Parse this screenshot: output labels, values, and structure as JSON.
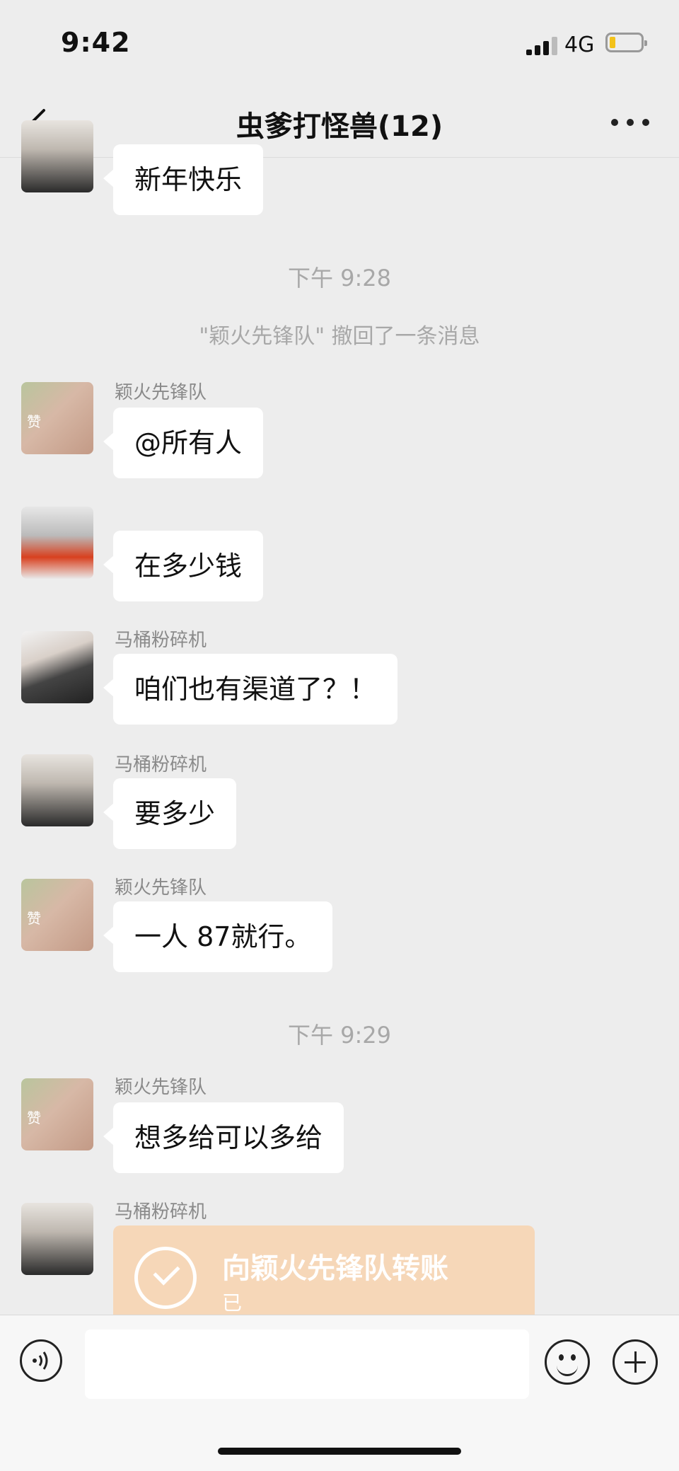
{
  "status": {
    "time": "9:42",
    "network": "4G"
  },
  "header": {
    "title": "虫爹打怪兽(12)"
  },
  "timestamps": [
    "下午 9:28",
    "下午 9:29"
  ],
  "system_message": "\"颖火先锋队\" 撤回了一条消息",
  "messages": [
    {
      "sender": "",
      "text": "新年快乐"
    },
    {
      "sender": "颖火先锋队",
      "text": "@所有人"
    },
    {
      "sender": "",
      "text": "在多少钱"
    },
    {
      "sender": "马桶粉碎机",
      "text": "咱们也有渠道了？！"
    },
    {
      "sender": "马桶粉碎机",
      "text": "要多少"
    },
    {
      "sender": "颖火先锋队",
      "text": "一人 87就行。"
    },
    {
      "sender": "颖火先锋队",
      "text": "想多给可以多给"
    },
    {
      "sender": "马桶粉碎机",
      "text": ""
    }
  ],
  "transfer": {
    "title": "向颖火先锋队转账",
    "subtitle": "已"
  },
  "avatar_stamp": "赞",
  "input": {
    "placeholder": ""
  }
}
